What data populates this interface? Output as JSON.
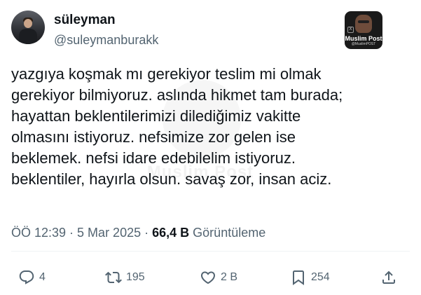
{
  "author": {
    "display_name": "süleyman",
    "handle": "@suleymanburakk",
    "avatar_icon": "user-avatar"
  },
  "watermark": {
    "badge_title": "Muslim Post",
    "badge_sub": "@MuslimPOST",
    "faint_text": "Muslim Post"
  },
  "tweet": {
    "lines": [
      "yazgıya koşmak mı gerekiyor teslim mi olmak",
      "gerekiyor bilmiyoruz. aslında hikmet tam burada;",
      "hayattan beklentilerimizi dilediğimiz vakitte",
      "olmasını istiyoruz. nefsimize zor gelen ise",
      "beklemek. nefsi idare edebilelim istiyoruz.",
      "beklentiler, hayırla olsun. savaş zor, insan aciz."
    ]
  },
  "meta": {
    "time": "ÖÖ 12:39",
    "separator": " · ",
    "date": "5 Mar 2025",
    "views_count": "66,4 B",
    "views_label": "Görüntüleme"
  },
  "actions": {
    "replies": "4",
    "reposts": "195",
    "likes": "2 B",
    "bookmarks": "254"
  },
  "colors": {
    "text_primary": "#0f1419",
    "text_secondary": "#536471",
    "divider": "#eff3f4"
  }
}
